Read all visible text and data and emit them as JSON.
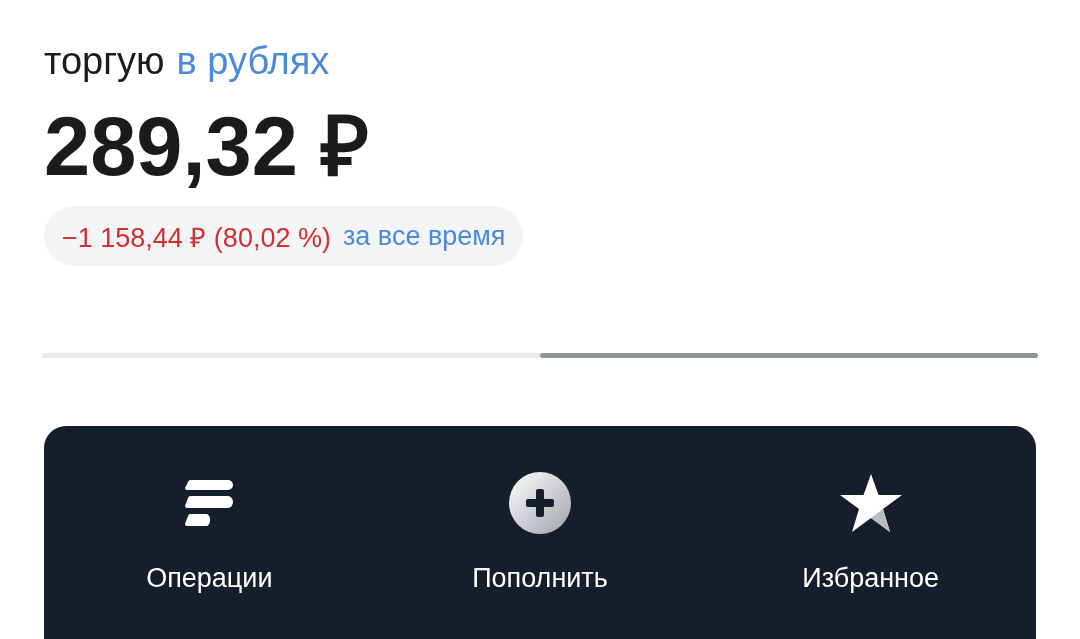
{
  "header": {
    "prefix": "торгую",
    "currency_link": "в рублях"
  },
  "balance": "289,32 ₽",
  "change": {
    "value": "−1 158,44 ₽ (80,02 %)",
    "negative": true,
    "period": "за все время"
  },
  "pager": [
    {
      "selected": false
    },
    {
      "selected": true
    }
  ],
  "actions": [
    {
      "label": "Операции",
      "kind": "operations"
    },
    {
      "label": "Пополнить",
      "kind": "top-up"
    },
    {
      "label": "Избранное",
      "kind": "favorites"
    }
  ]
}
